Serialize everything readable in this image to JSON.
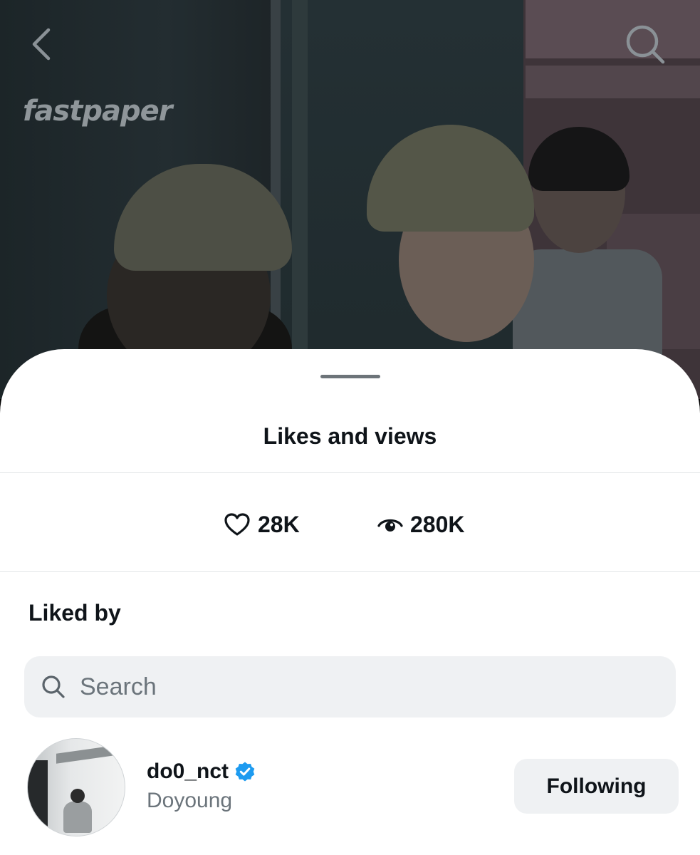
{
  "background": {
    "watermark": "fastpaper",
    "back_icon": "chevron-left-icon",
    "search_icon": "search-icon"
  },
  "sheet": {
    "title": "Likes and views",
    "stats": {
      "likes": {
        "icon": "heart-icon",
        "value": "28K"
      },
      "views": {
        "icon": "eye-icon",
        "value": "280K"
      }
    },
    "liked_by_heading": "Liked by",
    "search": {
      "placeholder": "Search",
      "value": ""
    },
    "users": [
      {
        "username": "do0_nct",
        "display_name": "Doyoung",
        "verified": true,
        "follow_label": "Following"
      }
    ]
  },
  "colors": {
    "text_primary": "#0f1419",
    "text_secondary": "#6b747b",
    "pill_bg": "#eff1f3",
    "verified_blue": "#1d9bf0"
  }
}
